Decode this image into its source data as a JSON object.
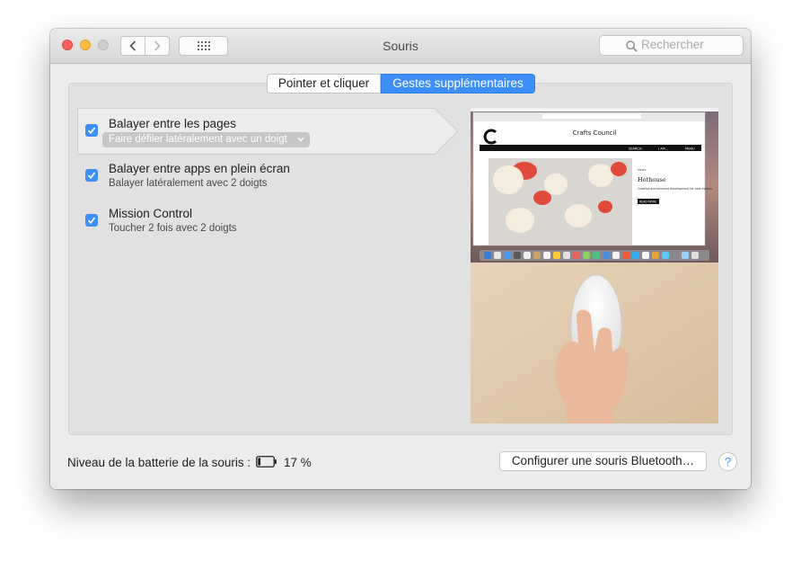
{
  "window": {
    "title": "Souris"
  },
  "search": {
    "placeholder": "Rechercher"
  },
  "tabs": [
    {
      "label": "Pointer et cliquer",
      "selected": false
    },
    {
      "label": "Gestes supplémentaires",
      "selected": true
    }
  ],
  "gestures": [
    {
      "title": "Balayer entre les pages",
      "subtitle": "Faire défiler latéralement avec un doigt",
      "checked": true,
      "has_popup": true
    },
    {
      "title": "Balayer entre apps en plein écran",
      "subtitle": "Balayer latéralement avec 2 doigts",
      "checked": true
    },
    {
      "title": "Mission Control",
      "subtitle": "Toucher 2 fois avec 2 doigts",
      "checked": true
    }
  ],
  "preview": {
    "site_title": "Crafts Council",
    "nav_search": "SEARCH",
    "nav_menu": "MENU",
    "nav_account": "I AM...",
    "article_tag": "News",
    "article_title": "Hothouse",
    "article_body": "Creative and business development for new makers",
    "article_button": "READ MORE"
  },
  "footer": {
    "battery_label": "Niveau de la batterie de la souris :",
    "battery_percent": "17 %",
    "battery_level": 0.17,
    "bluetooth_button": "Configurer une souris Bluetooth…",
    "help": "?"
  },
  "colors": {
    "accent": "#3d8ff7",
    "window_bg": "#ececec",
    "panel_bg": "#e1e1e1"
  }
}
